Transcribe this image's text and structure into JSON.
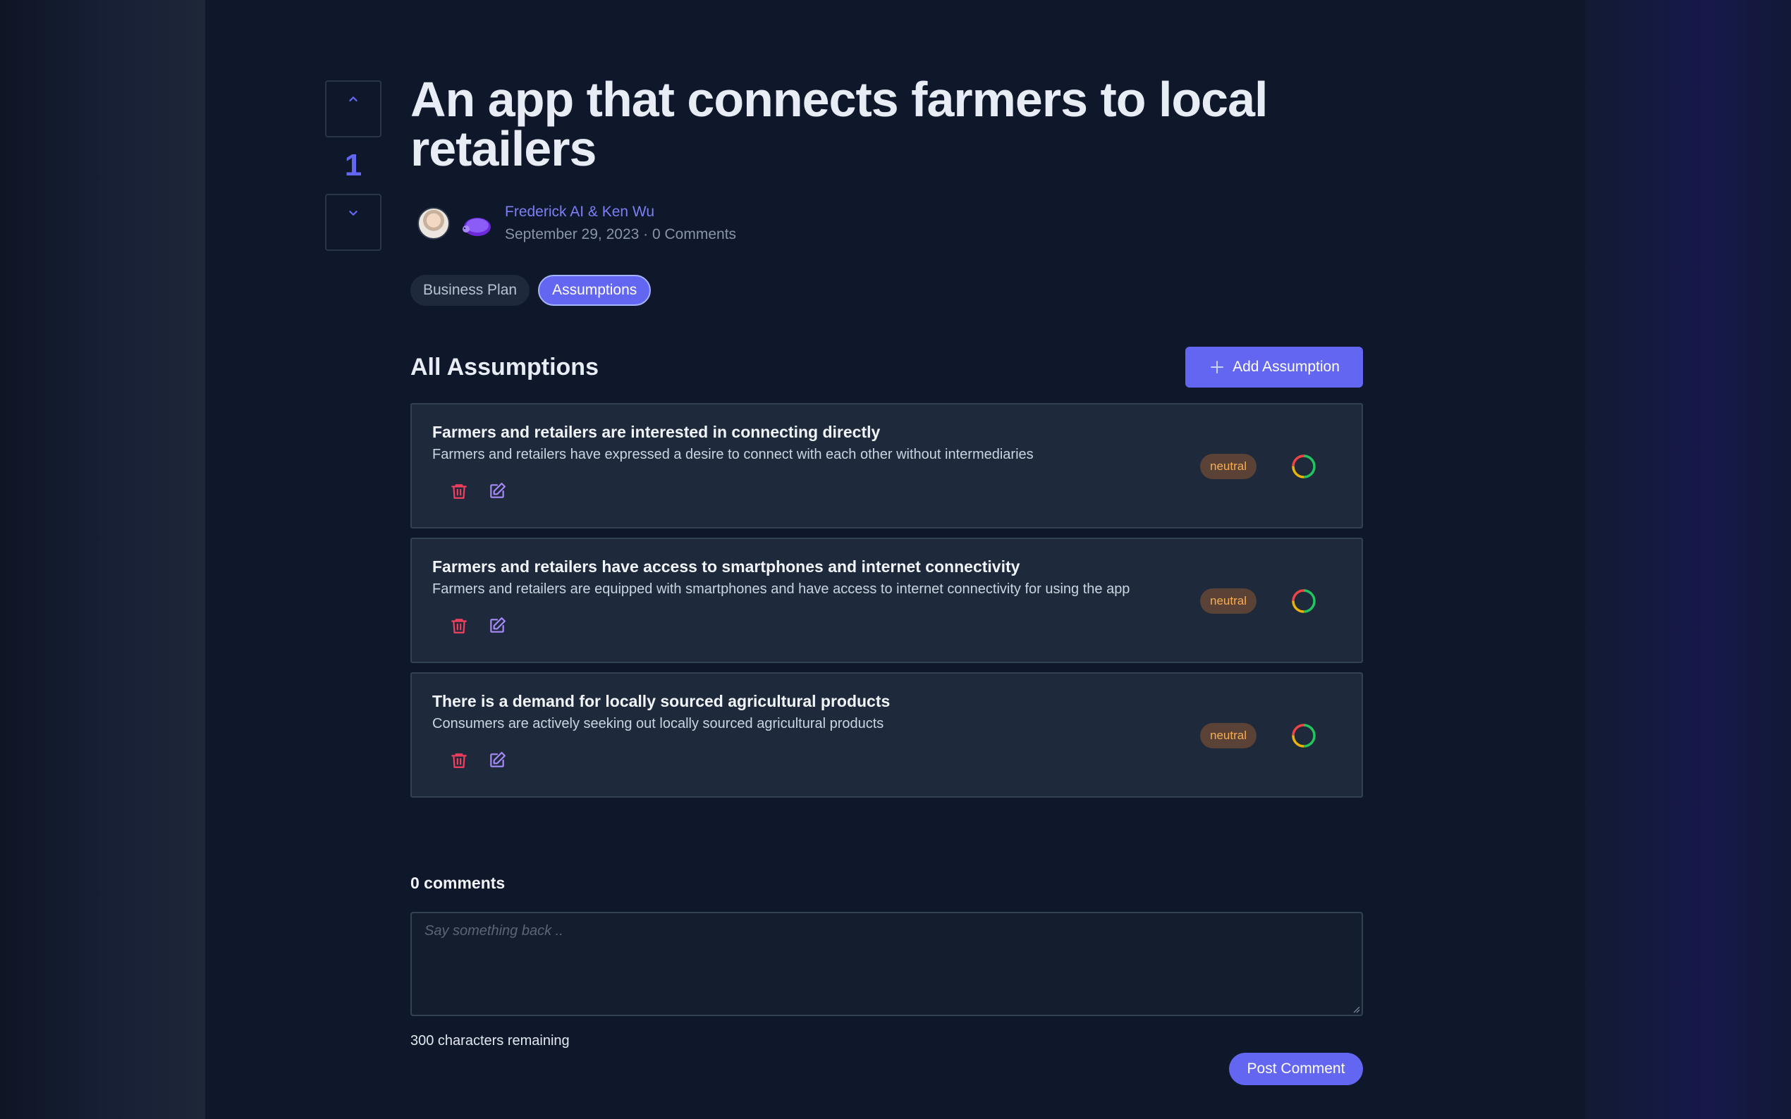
{
  "post": {
    "title": "An app that connects farmers to local retailers",
    "vote_count": "1",
    "authors": "Frederick AI & Ken Wu",
    "date": "September 29, 2023",
    "comments_meta": "0 Comments",
    "separator": "·"
  },
  "tabs": [
    {
      "label": "Business Plan",
      "active": false
    },
    {
      "label": "Assumptions",
      "active": true
    }
  ],
  "assumptions_section": {
    "title": "All Assumptions",
    "add_button": "Add Assumption"
  },
  "assumptions": [
    {
      "title": "Farmers and retailers are interested in connecting directly",
      "description": "Farmers and retailers have expressed a desire to connect with each other without intermediaries",
      "status": "neutral"
    },
    {
      "title": "Farmers and retailers have access to smartphones and internet connectivity",
      "description": "Farmers and retailers are equipped with smartphones and have access to internet connectivity for using the app",
      "status": "neutral"
    },
    {
      "title": "There is a demand for locally sourced agricultural products",
      "description": "Consumers are actively seeking out locally sourced agricultural products",
      "status": "neutral"
    }
  ],
  "comments": {
    "title": "0 comments",
    "placeholder": "Say something back ..",
    "chars_remaining": "300 characters remaining",
    "post_button": "Post Comment"
  },
  "colors": {
    "accent": "#6366f1",
    "delete": "#f43f5e",
    "edit": "#a78bfa",
    "neutral_badge_bg": "#5b4236",
    "neutral_badge_text": "#f6ad55"
  },
  "icons": [
    "chevron-up-icon",
    "chevron-down-icon",
    "plus-icon",
    "trash-icon",
    "edit-icon",
    "status-ring-icon"
  ]
}
